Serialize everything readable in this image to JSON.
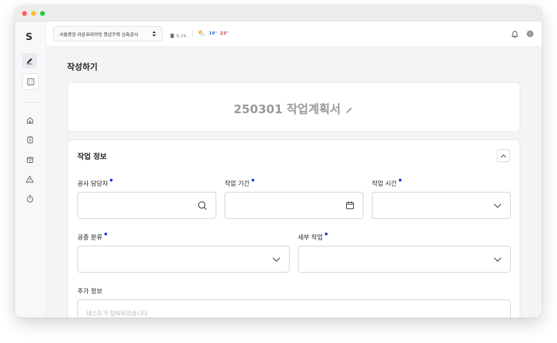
{
  "app": {
    "logo": "S"
  },
  "topbar": {
    "project": "서울중앙 라온프라이빗 청년주택 신축공사",
    "date_day": "월",
    "date_value": "9.26.",
    "temp_min": "18°",
    "temp_max": "23°"
  },
  "page": {
    "title": "작성하기"
  },
  "document": {
    "title": "250301 작업계획서"
  },
  "section": {
    "title": "작업 정보"
  },
  "fields": {
    "manager": {
      "label": "공사 담당자",
      "value": ""
    },
    "period": {
      "label": "작업 기간",
      "value": ""
    },
    "time": {
      "label": "작업 시간",
      "value": ""
    },
    "category": {
      "label": "공종 분류",
      "value": ""
    },
    "detail": {
      "label": "세부 작업",
      "value": ""
    },
    "extra": {
      "label": "추가 정보",
      "value": "테스트가 입력되었습니다"
    }
  },
  "colors": {
    "required_dot": "#1d3bd8",
    "temp_min": "#2f6fde",
    "temp_max": "#e03b3b"
  },
  "icons": [
    "pencil-icon",
    "grid-icon",
    "home-icon",
    "clipboard-icon",
    "calendar-icon",
    "warning-icon",
    "timer-icon",
    "bell-icon",
    "gear-icon",
    "search-icon",
    "chevron-down-icon",
    "chevron-up-icon",
    "weather-icon"
  ]
}
